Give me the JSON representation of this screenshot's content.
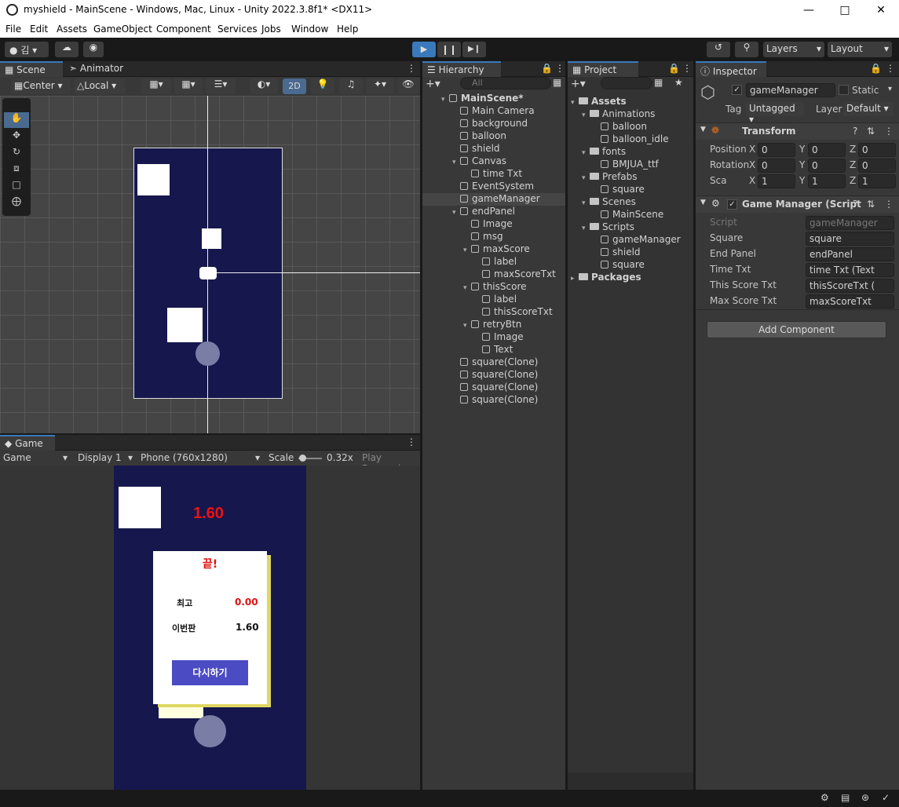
{
  "window": {
    "title": "myshield - MainScene - Windows, Mac, Linux - Unity 2022.3.8f1* <DX11>"
  },
  "menu": [
    "File",
    "Edit",
    "Assets",
    "GameObject",
    "Component",
    "Services",
    "Jobs",
    "Window",
    "Help"
  ],
  "toolbar": {
    "account": "김",
    "layers": "Layers",
    "layout": "Layout"
  },
  "scene": {
    "tabs": [
      "Scene",
      "Animator"
    ],
    "pivot": "Center",
    "space": "Local",
    "mode2d": "2D"
  },
  "game": {
    "tab": "Game",
    "view": "Game",
    "display": "Display 1",
    "resolution": "Phone (760x1280)",
    "scale_label": "Scale",
    "scale_value": "0.32x",
    "play_focused": "Play Focused",
    "time": "1.60",
    "panel": {
      "title": "끝!",
      "best_label": "최고",
      "best_value": "0.00",
      "this_label": "이번판",
      "this_value": "1.60",
      "retry": "다시하기"
    }
  },
  "hierarchy": {
    "tab": "Hierarchy",
    "search": "All",
    "items": [
      {
        "label": "MainScene*",
        "depth": 0
      },
      {
        "label": "Main Camera",
        "depth": 1
      },
      {
        "label": "background",
        "depth": 1
      },
      {
        "label": "balloon",
        "depth": 1
      },
      {
        "label": "shield",
        "depth": 1
      },
      {
        "label": "Canvas",
        "depth": 1
      },
      {
        "label": "time Txt",
        "depth": 2
      },
      {
        "label": "EventSystem",
        "depth": 1
      },
      {
        "label": "gameManager",
        "depth": 1
      },
      {
        "label": "endPanel",
        "depth": 1
      },
      {
        "label": "Image",
        "depth": 2
      },
      {
        "label": "msg",
        "depth": 2
      },
      {
        "label": "maxScore",
        "depth": 2
      },
      {
        "label": "label",
        "depth": 3
      },
      {
        "label": "maxScoreTxt",
        "depth": 3
      },
      {
        "label": "thisScore",
        "depth": 2
      },
      {
        "label": "label",
        "depth": 3
      },
      {
        "label": "thisScoreTxt",
        "depth": 3
      },
      {
        "label": "retryBtn",
        "depth": 2
      },
      {
        "label": "Image",
        "depth": 3
      },
      {
        "label": "Text",
        "depth": 3
      },
      {
        "label": "square(Clone)",
        "depth": 1
      },
      {
        "label": "square(Clone)",
        "depth": 1
      },
      {
        "label": "square(Clone)",
        "depth": 1
      },
      {
        "label": "square(Clone)",
        "depth": 1
      }
    ]
  },
  "project": {
    "tab": "Project",
    "items": [
      {
        "label": "Assets",
        "depth": 0
      },
      {
        "label": "Animations",
        "depth": 1
      },
      {
        "label": "balloon",
        "depth": 2
      },
      {
        "label": "balloon_idle",
        "depth": 2
      },
      {
        "label": "fonts",
        "depth": 1
      },
      {
        "label": "BMJUA_ttf",
        "depth": 2
      },
      {
        "label": "Prefabs",
        "depth": 1
      },
      {
        "label": "square",
        "depth": 2
      },
      {
        "label": "Scenes",
        "depth": 1
      },
      {
        "label": "MainScene",
        "depth": 2
      },
      {
        "label": "Scripts",
        "depth": 1
      },
      {
        "label": "gameManager",
        "depth": 2
      },
      {
        "label": "shield",
        "depth": 2
      },
      {
        "label": "square",
        "depth": 2
      },
      {
        "label": "Packages",
        "depth": 0
      }
    ]
  },
  "inspector": {
    "tab": "Inspector",
    "object_name": "gameManager",
    "static": "Static",
    "tag_label": "Tag",
    "tag": "Untagged",
    "layer_label": "Layer",
    "layer": "Default",
    "transform": {
      "title": "Transform",
      "position": {
        "label": "Position",
        "x": "0",
        "y": "0",
        "z": "0"
      },
      "rotation": {
        "label": "Rotation",
        "x": "0",
        "y": "0",
        "z": "0"
      },
      "scale": {
        "label": "Sca",
        "x": "1",
        "y": "1",
        "z": "1"
      }
    },
    "script": {
      "title": "Game Manager (Script",
      "fields": [
        {
          "label": "Script",
          "value": "gameManager"
        },
        {
          "label": "Square",
          "value": "square"
        },
        {
          "label": "End Panel",
          "value": "endPanel"
        },
        {
          "label": "Time Txt",
          "value": "time Txt (Text"
        },
        {
          "label": "This Score Txt",
          "value": "thisScoreTxt ("
        },
        {
          "label": "Max Score Txt",
          "value": "maxScoreTxt"
        }
      ]
    },
    "add_component": "Add Component"
  }
}
